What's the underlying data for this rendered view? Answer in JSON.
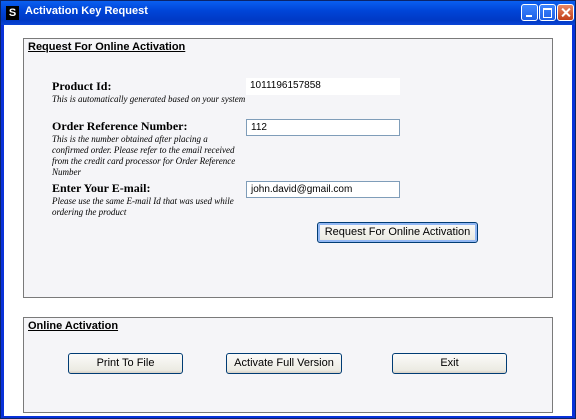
{
  "window": {
    "title": "Activation Key Request",
    "icon_letter": "S"
  },
  "request_group": {
    "title": "Request For Online Activation",
    "product_id": {
      "label": "Product Id:",
      "hint": "This is automatically generated based on your system",
      "value": "1011196157858"
    },
    "order_ref": {
      "label": "Order Reference Number:",
      "hint": "This is the number obtained after placing a confirmed order. Please refer to the email received from the credit card processor for Order Reference Number",
      "value": "112"
    },
    "email": {
      "label": "Enter Your E-mail:",
      "hint": "Please use the same E-mail Id that was used while ordering the product",
      "value": "john.david@gmail.com"
    },
    "submit_label": "Request For Online Activation"
  },
  "online_group": {
    "title": "Online Activation",
    "print_label": "Print To File",
    "activate_label": "Activate Full Version",
    "exit_label": "Exit"
  }
}
